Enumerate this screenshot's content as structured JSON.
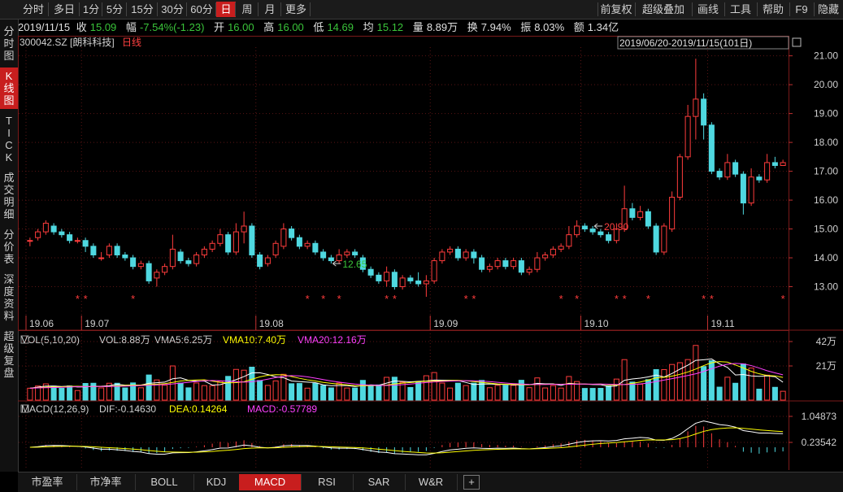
{
  "toolbar": {
    "left": [
      "分时",
      "多日",
      "1分",
      "5分",
      "15分",
      "30分",
      "60分",
      "日",
      "周",
      "月",
      "更多"
    ],
    "active_index": 7,
    "right": [
      "前复权",
      "超级叠加",
      "画线",
      "工具",
      "帮助",
      "F9",
      "隐藏"
    ]
  },
  "sidebar": {
    "items": [
      "分时图",
      "K线图",
      "TICK",
      "成交明细",
      "分价表",
      "深度资料",
      "超级复盘"
    ],
    "active_index": 1
  },
  "info": {
    "date": "2019/11/15",
    "close_label": "收",
    "close": "15.09",
    "change_label": "幅",
    "change": "-7.54%(-1.23)",
    "open_label": "开",
    "open": "16.00",
    "high_label": "高",
    "high": "16.00",
    "low_label": "低",
    "low": "14.69",
    "avg_label": "均",
    "avg": "15.12",
    "vol_label": "量",
    "vol": "8.89万",
    "turnover_label": "换",
    "turnover": "7.94%",
    "amp_label": "振",
    "amp": "8.03%",
    "amount_label": "额",
    "amount": "1.34亿"
  },
  "stock": {
    "code": "300042.SZ",
    "name": "[朗科科技]",
    "period": "日线"
  },
  "range_label": "2019/06/20-2019/11/15(101日)",
  "colors": {
    "up": "#ff3c3c",
    "down": "#4fd8e0",
    "ma5": "#ffffff",
    "ma10": "#ffff00",
    "ma20": "#ff40ff",
    "grid": "#5a1414"
  },
  "chart_data": {
    "type": "candlestick",
    "price_axis": [
      "21.00",
      "20.00",
      "19.00",
      "18.00",
      "17.00",
      "16.00",
      "15.00",
      "14.00",
      "13.00"
    ],
    "price_range": [
      12.0,
      21.3
    ],
    "months": [
      {
        "label": "19.06",
        "index": 0
      },
      {
        "label": "19.07",
        "index": 7
      },
      {
        "label": "19.08",
        "index": 29
      },
      {
        "label": "19.09",
        "index": 51
      },
      {
        "label": "19.10",
        "index": 70
      },
      {
        "label": "19.11",
        "index": 86
      }
    ],
    "high_mark": {
      "label": "20.90",
      "index": 71
    },
    "low_mark": {
      "label": "12.65",
      "index": 38
    },
    "star_indices": [
      6,
      7,
      13,
      35,
      37,
      39,
      45,
      46,
      55,
      56,
      67,
      69,
      74,
      75,
      78,
      85,
      86,
      95,
      98
    ],
    "candles": [
      [
        14.6,
        14.6,
        14.4,
        14.7
      ],
      [
        14.7,
        14.9,
        14.6,
        15.0
      ],
      [
        14.9,
        15.2,
        14.8,
        15.3
      ],
      [
        15.1,
        14.9,
        14.8,
        15.2
      ],
      [
        14.9,
        14.8,
        14.7,
        15.0
      ],
      [
        14.8,
        14.6,
        14.5,
        14.9
      ],
      [
        14.6,
        14.6,
        14.5,
        14.7
      ],
      [
        14.6,
        14.4,
        14.2,
        14.7
      ],
      [
        14.4,
        14.1,
        14.0,
        14.5
      ],
      [
        14.0,
        14.0,
        13.9,
        14.2
      ],
      [
        14.1,
        14.4,
        14.0,
        14.5
      ],
      [
        14.4,
        14.1,
        14.0,
        14.5
      ],
      [
        14.1,
        14.0,
        13.9,
        14.2
      ],
      [
        14.0,
        13.7,
        13.6,
        14.1
      ],
      [
        13.7,
        13.8,
        13.6,
        13.9
      ],
      [
        13.8,
        13.2,
        13.1,
        13.9
      ],
      [
        13.3,
        13.5,
        13.0,
        13.6
      ],
      [
        13.5,
        13.7,
        13.4,
        13.8
      ],
      [
        13.7,
        14.3,
        13.6,
        14.8
      ],
      [
        14.2,
        13.9,
        13.8,
        14.3
      ],
      [
        13.9,
        13.8,
        13.7,
        14.0
      ],
      [
        13.8,
        14.1,
        13.7,
        14.2
      ],
      [
        14.1,
        14.3,
        14.0,
        14.4
      ],
      [
        14.3,
        14.5,
        14.2,
        14.6
      ],
      [
        14.5,
        14.8,
        14.4,
        15.0
      ],
      [
        14.8,
        14.2,
        14.1,
        14.9
      ],
      [
        14.2,
        14.9,
        14.1,
        15.2
      ],
      [
        14.9,
        15.1,
        14.5,
        15.6
      ],
      [
        15.1,
        14.1,
        14.0,
        15.2
      ],
      [
        14.1,
        13.7,
        13.6,
        14.2
      ],
      [
        13.8,
        14.0,
        13.7,
        14.1
      ],
      [
        14.1,
        14.5,
        14.0,
        14.6
      ],
      [
        14.4,
        15.0,
        14.3,
        15.2
      ],
      [
        15.0,
        14.7,
        14.6,
        15.1
      ],
      [
        14.7,
        14.4,
        14.3,
        14.8
      ],
      [
        14.4,
        14.5,
        14.3,
        14.6
      ],
      [
        14.5,
        14.2,
        14.1,
        14.6
      ],
      [
        14.2,
        14.0,
        13.9,
        14.3
      ],
      [
        14.0,
        13.9,
        13.8,
        14.1
      ],
      [
        13.9,
        14.1,
        13.8,
        14.3
      ],
      [
        14.1,
        14.2,
        14.0,
        14.3
      ],
      [
        14.2,
        14.1,
        14.0,
        14.3
      ],
      [
        14.0,
        13.6,
        13.5,
        14.1
      ],
      [
        13.6,
        13.4,
        13.3,
        13.7
      ],
      [
        13.4,
        13.2,
        13.1,
        13.5
      ],
      [
        13.2,
        13.5,
        13.0,
        13.7
      ],
      [
        13.5,
        13.0,
        12.9,
        13.6
      ],
      [
        13.0,
        13.3,
        12.9,
        13.4
      ],
      [
        13.3,
        13.2,
        13.1,
        13.4
      ],
      [
        13.2,
        13.1,
        13.0,
        13.5
      ],
      [
        13.1,
        13.2,
        12.65,
        13.4
      ],
      [
        13.2,
        13.9,
        13.1,
        14.0
      ],
      [
        13.9,
        14.2,
        13.8,
        14.3
      ],
      [
        14.2,
        14.3,
        14.1,
        14.4
      ],
      [
        14.3,
        14.0,
        13.9,
        14.4
      ],
      [
        14.0,
        14.2,
        13.9,
        14.3
      ],
      [
        14.2,
        14.0,
        13.8,
        14.3
      ],
      [
        14.0,
        13.6,
        13.5,
        14.1
      ],
      [
        13.6,
        13.7,
        13.5,
        13.8
      ],
      [
        13.7,
        13.9,
        13.6,
        14.0
      ],
      [
        13.9,
        13.7,
        13.6,
        14.0
      ],
      [
        13.7,
        13.9,
        13.6,
        14.0
      ],
      [
        13.9,
        13.5,
        13.4,
        14.0
      ],
      [
        13.5,
        13.6,
        13.4,
        13.7
      ],
      [
        13.6,
        14.0,
        13.5,
        14.2
      ],
      [
        14.0,
        14.1,
        13.9,
        14.2
      ],
      [
        14.1,
        14.3,
        14.0,
        14.4
      ],
      [
        14.3,
        14.4,
        14.2,
        14.5
      ],
      [
        14.4,
        14.8,
        14.3,
        15.1
      ],
      [
        14.8,
        15.1,
        14.7,
        15.3
      ],
      [
        15.1,
        15.0,
        14.9,
        15.2
      ],
      [
        15.0,
        14.9,
        14.8,
        15.1
      ],
      [
        14.9,
        14.8,
        14.7,
        15.0
      ],
      [
        14.8,
        14.6,
        14.5,
        14.9
      ],
      [
        14.6,
        15.0,
        14.5,
        15.2
      ],
      [
        15.0,
        15.7,
        14.9,
        16.5
      ],
      [
        15.7,
        15.4,
        15.3,
        15.9
      ],
      [
        15.4,
        15.6,
        15.3,
        15.8
      ],
      [
        15.6,
        15.1,
        15.0,
        15.7
      ],
      [
        15.1,
        14.2,
        14.1,
        15.2
      ],
      [
        14.2,
        15.1,
        14.1,
        15.2
      ],
      [
        15.0,
        16.1,
        14.9,
        16.3
      ],
      [
        16.1,
        17.5,
        16.0,
        17.6
      ],
      [
        17.5,
        18.9,
        17.4,
        19.3
      ],
      [
        18.9,
        19.5,
        18.1,
        20.9
      ],
      [
        19.5,
        18.6,
        18.1,
        19.7
      ],
      [
        18.6,
        17.0,
        16.9,
        18.7
      ],
      [
        17.0,
        16.8,
        16.7,
        17.1
      ],
      [
        16.8,
        17.3,
        16.7,
        17.6
      ],
      [
        17.3,
        16.9,
        16.8,
        17.4
      ],
      [
        16.9,
        15.9,
        15.5,
        17.0
      ],
      [
        15.9,
        16.8,
        15.8,
        17.1
      ],
      [
        16.8,
        16.7,
        16.6,
        16.9
      ],
      [
        16.7,
        17.3,
        16.6,
        17.6
      ],
      [
        17.3,
        17.2,
        17.1,
        17.5
      ],
      [
        17.2,
        17.3,
        17.2,
        17.4
      ]
    ],
    "volume": {
      "label": "VOL(5,10,20)",
      "vol_label": "VOL:8.88万",
      "vma5_label": "VMA5:6.25万",
      "vma10_label": "VMA10:7.40万",
      "vma20_label": "VMA20:12.16万",
      "axis": [
        "42万",
        "21万"
      ]
    },
    "macd": {
      "label": "MACD(12,26,9)",
      "dif_label": "DIF:-0.14630",
      "dea_label": "DEA:0.14264",
      "macd_label": "MACD:-0.57789",
      "axis": [
        "1.04873",
        "0.23542"
      ]
    }
  },
  "tabs": [
    "市盈率",
    "市净率",
    "BOLL",
    "KDJ",
    "MACD",
    "RSI",
    "SAR",
    "W&R"
  ],
  "tabs_active_index": 4
}
